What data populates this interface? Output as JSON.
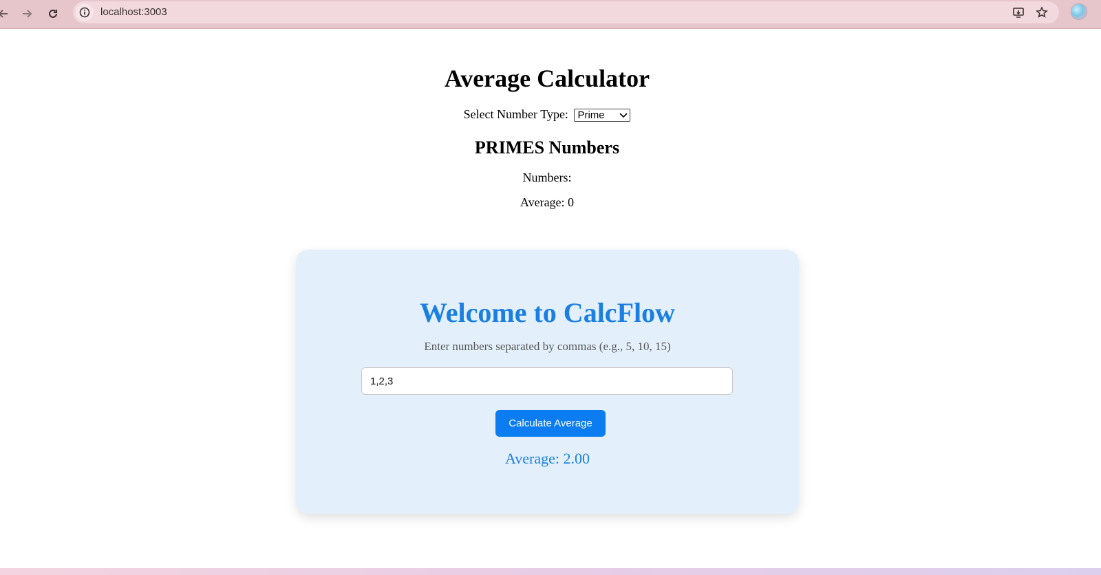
{
  "browser": {
    "url": "localhost:3003",
    "icons": [
      "back-arrow-icon",
      "forward-arrow-icon",
      "reload-icon",
      "info-icon",
      "install-app-icon",
      "bookmark-star-icon",
      "profile-avatar-icon"
    ]
  },
  "page": {
    "title": "Average Calculator",
    "select_label": "Select Number Type:",
    "select_value": "Prime",
    "section_heading": "PRIMES Numbers",
    "numbers_label": "Numbers:",
    "average_label": "Average: 0"
  },
  "card": {
    "title": "Welcome to CalcFlow",
    "subtitle": "Enter numbers separated by commas (e.g., 5, 10, 15)",
    "input_value": "1,2,3",
    "button_label": "Calculate Average",
    "result": "Average: 2.00"
  },
  "colors": {
    "toolbar": "#e6c5cb",
    "card_bg": "#e3f0fb",
    "accent": "#1a7fe0",
    "button": "#0b7df0"
  }
}
